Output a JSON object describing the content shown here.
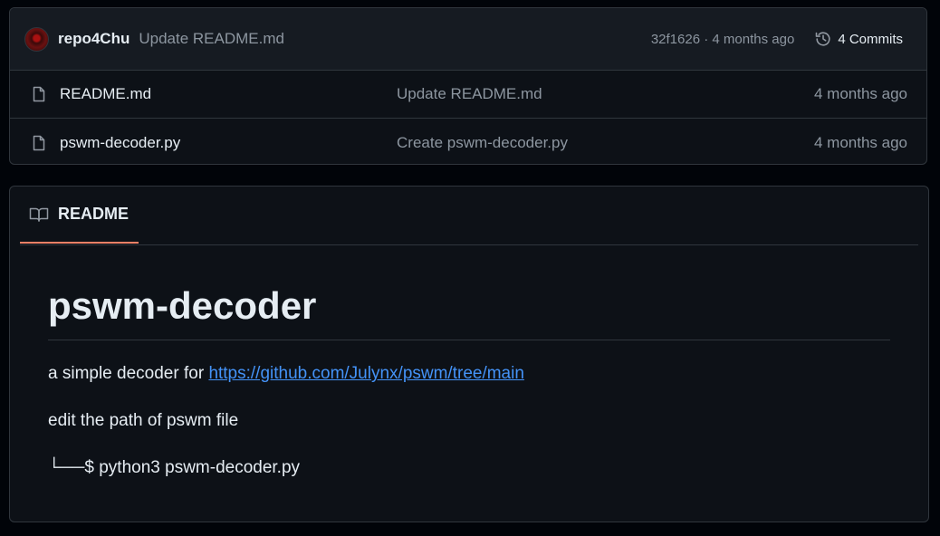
{
  "commit_header": {
    "author": "repo4Chu",
    "message": "Update README.md",
    "hash": "32f1626",
    "separator": "·",
    "age": "4 months ago",
    "commits_label": "4 Commits",
    "icon": "history-icon"
  },
  "files": [
    {
      "name": "README.md",
      "commit_message": "Update README.md",
      "age": "4 months ago",
      "icon": "file-icon"
    },
    {
      "name": "pswm-decoder.py",
      "commit_message": "Create pswm-decoder.py",
      "age": "4 months ago",
      "icon": "file-icon"
    }
  ],
  "readme": {
    "tab_label": "README",
    "tab_icon": "book-icon",
    "title": "pswm-decoder",
    "intro_text": "a simple decoder for",
    "link_text": "https://github.com/Julynx/pswm/tree/main",
    "instruction": "edit the path of pswm file",
    "command": "└──$ python3 pswm-decoder.py"
  },
  "colors": {
    "background": "#0d1117",
    "border": "#30363d",
    "link": "#4493f8",
    "tab_underline": "#f78166",
    "muted_text": "#8d96a0"
  }
}
